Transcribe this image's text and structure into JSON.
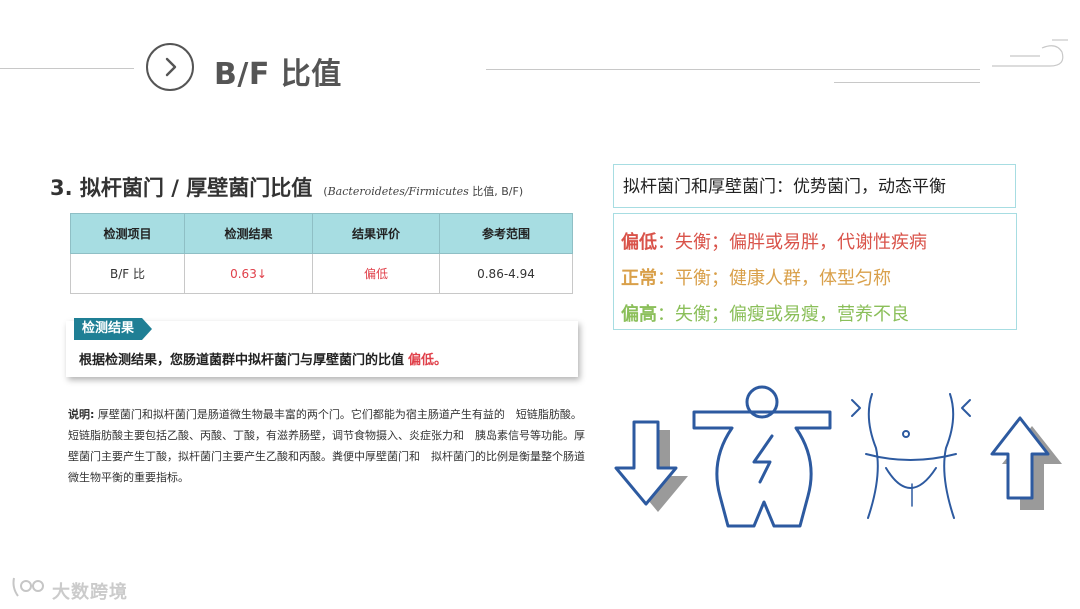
{
  "header": {
    "title": "B/F 比值",
    "icon": "chevron-right-icon"
  },
  "section": {
    "heading": "3. 拟杆菌门 / 厚壁菌门比值",
    "subtitle_open": "(",
    "subtitle_italic": "Bacteroidetes/Firmicutes",
    "subtitle_rest": " 比值, B/F)"
  },
  "table": {
    "headers": [
      "检测项目",
      "检测结果",
      "结果评价",
      "参考范围"
    ],
    "row": {
      "item": "B/F 比",
      "result": "0.63↓",
      "evaluation": "偏低",
      "reference": "0.86-4.94"
    }
  },
  "result_box": {
    "tag": "检测结果",
    "text": "根据检测结果，您肠道菌群中拟杆菌门与厚壁菌门的比值",
    "highlight": "偏低。"
  },
  "note": {
    "label": "说明:",
    "text": "厚壁菌门和拟杆菌门是肠道微生物最丰富的两个门。它们都能为宿主肠道产生有益的　短链脂肪酸。短链脂肪酸主要包括乙酸、丙酸、丁酸，有滋养肠壁，调节食物摄入、炎症张力和　胰岛素信号等功能。厚壁菌门主要产生丁酸，拟杆菌门主要产生乙酸和丙酸。粪便中厚壁菌门和　拟杆菌门的比例是衡量整个肠道微生物平衡的重要指标。"
  },
  "right_panel": {
    "title": "拟杆菌门和厚壁菌门：优势菌门，动态平衡",
    "statuses": [
      {
        "key": "偏低",
        "text": "：失衡；偏胖或易胖，代谢性疾病",
        "color": "#d9534a"
      },
      {
        "key": "正常",
        "text": "：平衡；健康人群，体型匀称",
        "color": "#d9a04a"
      },
      {
        "key": "偏高",
        "text": "：失衡；偏瘦或易瘦，营养不良",
        "color": "#8bbf5a"
      }
    ]
  },
  "illustrations": [
    "arrow-down-icon",
    "overweight-body-icon",
    "slim-waist-icon",
    "arrow-up-icon"
  ],
  "colors": {
    "accent": "#a7dde2",
    "tag": "#1f7f95",
    "alert": "#e0404a",
    "illus": "#2d5aa0"
  },
  "watermark": {
    "text": "大数跨境"
  }
}
